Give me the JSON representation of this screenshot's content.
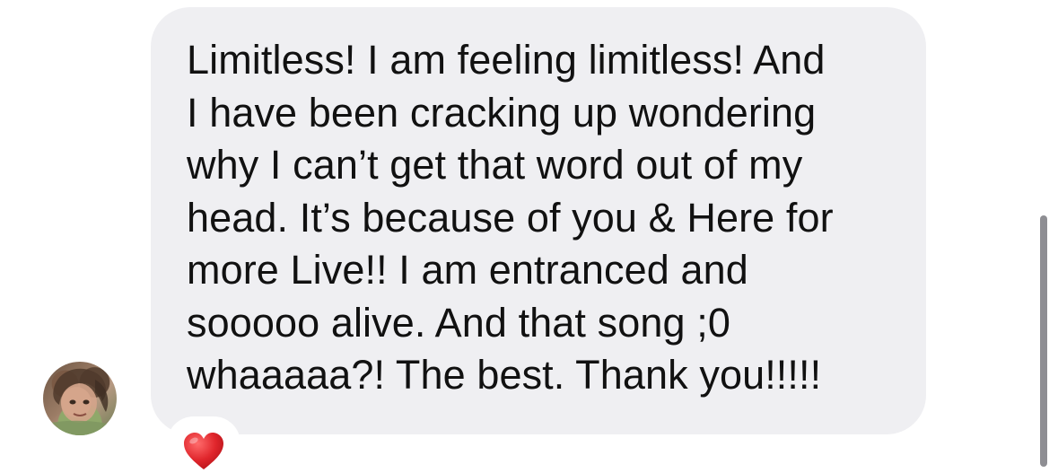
{
  "message": {
    "lines": [
      "Limitless! I am feeling limitless! And",
      "I have been cracking up wondering",
      "why I can’t get that word out of my",
      "head. It’s because of you & Here for",
      "more Live!! I am entranced and",
      "sooooo alive. And that song ;0",
      "whaaaaa?! The best. Thank you!!!!!"
    ],
    "bubble_color": "#efeff2",
    "text_color": "#111111"
  },
  "sender": {
    "avatar_icon": "profile-photo"
  },
  "reaction": {
    "icon": "red-heart-icon",
    "color": "#e0262c"
  },
  "scrollbar": {
    "color": "#8e8e93"
  }
}
